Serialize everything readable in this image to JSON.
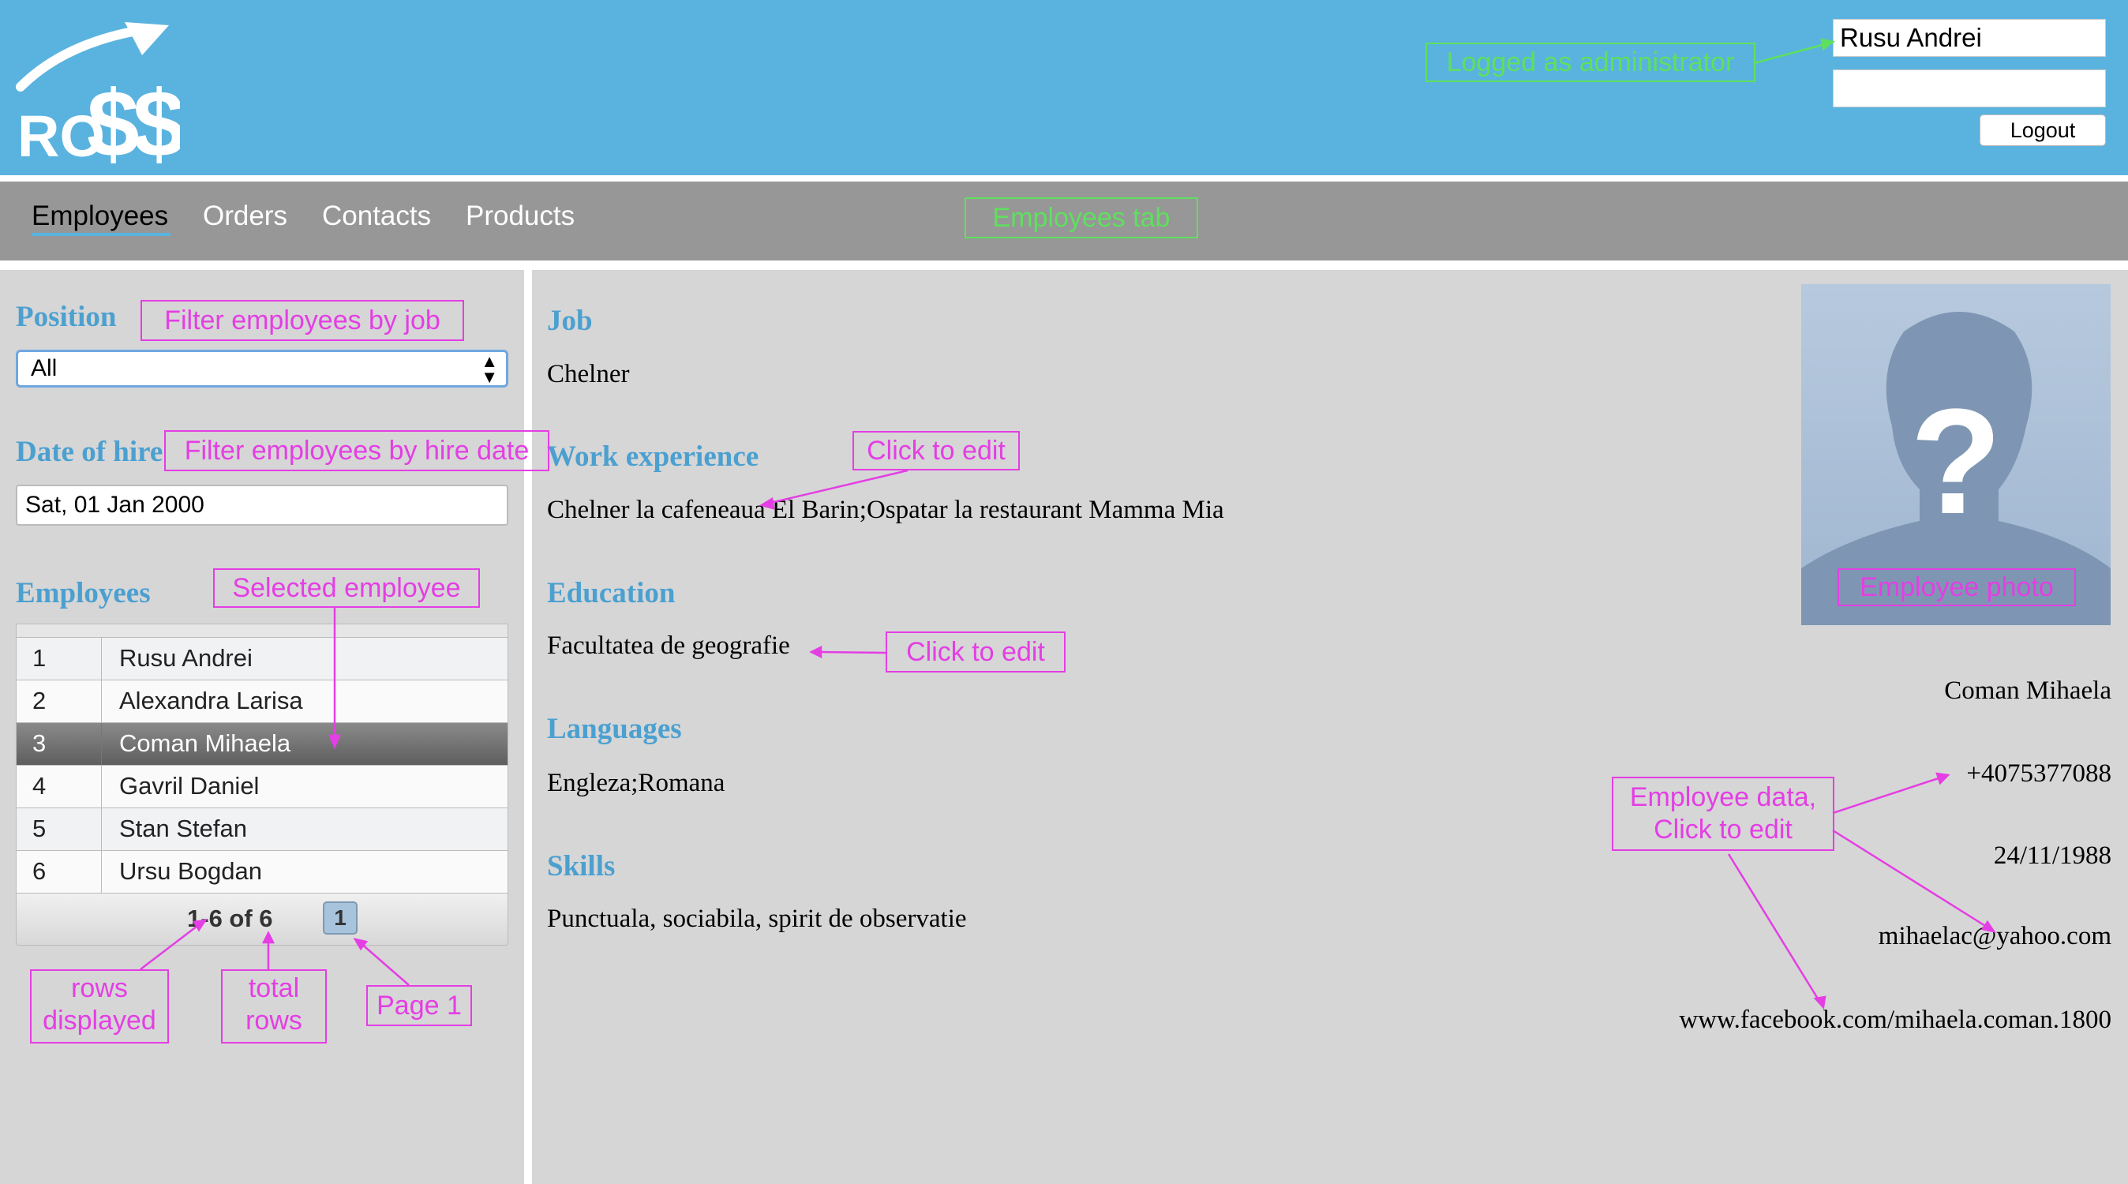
{
  "app": {
    "logo_text": "RO$$",
    "user_name": "Rusu Andrei",
    "user_role": "",
    "logout_label": "Logout"
  },
  "nav": {
    "tabs": [
      {
        "label": "Employees",
        "active": true
      },
      {
        "label": "Orders",
        "active": false
      },
      {
        "label": "Contacts",
        "active": false
      },
      {
        "label": "Products",
        "active": false
      }
    ]
  },
  "filters": {
    "position_label": "Position",
    "position_value": "All",
    "hire_label": "Date of hire",
    "hire_value": "Sat, 01 Jan 2000",
    "employees_label": "Employees"
  },
  "employees": {
    "rows": [
      {
        "id": "1",
        "name": "Rusu Andrei"
      },
      {
        "id": "2",
        "name": "Alexandra Larisa"
      },
      {
        "id": "3",
        "name": "Coman Mihaela"
      },
      {
        "id": "4",
        "name": "Gavril Daniel"
      },
      {
        "id": "5",
        "name": "Stan Stefan"
      },
      {
        "id": "6",
        "name": "Ursu Bogdan"
      }
    ],
    "selected_id": "3",
    "pager_info": "1-6 of 6",
    "page": "1"
  },
  "details": {
    "job_label": "Job",
    "job": "Chelner",
    "experience_label": "Work experience",
    "experience": "Chelner la cafeneaua El Barin;Ospatar la restaurant Mamma Mia",
    "education_label": "Education",
    "education": "Facultatea de geografie",
    "languages_label": "Languages",
    "languages": "Engleza;Romana",
    "skills_label": "Skills",
    "skills": "Punctuala, sociabila, spirit de observatie"
  },
  "contact": {
    "name": "Coman Mihaela",
    "phone": "+4075377088",
    "birthdate": "24/11/1988",
    "email": "mihaelac@yahoo.com",
    "facebook": "www.facebook.com/mihaela.coman.1800"
  },
  "annotations": {
    "logged_as": "Logged as administrator",
    "employees_tab": "Employees tab",
    "filter_job": "Filter employees by job",
    "filter_hire": "Filter employees by hire date",
    "selected_employee": "Selected employee",
    "click_to_edit_1": "Click to edit",
    "click_to_edit_2": "Click to edit",
    "employee_photo": "Employee photo",
    "employee_data_1": "Employee data,",
    "employee_data_2": "Click to edit",
    "rows_displayed_1": "rows",
    "rows_displayed_2": "displayed",
    "total_rows_1": "total",
    "total_rows_2": "rows",
    "page_1": "Page 1"
  },
  "colors": {
    "header_bg": "#5ab3df",
    "nav_bg": "#979797",
    "panel_bg": "#d6d6d6",
    "section_label": "#4ba0d0",
    "annotation_pink": "#e43ee4",
    "annotation_green": "#5ee05e"
  },
  "icons": {
    "logo": "rising-arrow-dollar-logo",
    "select_arrows": "up-down-arrows-icon",
    "photo": "unknown-person-silhouette-icon"
  }
}
